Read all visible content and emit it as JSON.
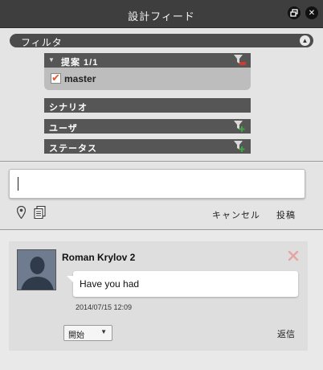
{
  "window": {
    "title": "設計フィード"
  },
  "filter": {
    "label": "フィルタ",
    "proposal": {
      "label": "提案 1/1",
      "item": {
        "label": "master",
        "checked": true
      }
    },
    "scenario": {
      "label": "シナリオ"
    },
    "user": {
      "label": "ユーザ"
    },
    "status": {
      "label": "ステータス"
    }
  },
  "composer": {
    "value": "",
    "cancel_label": "キャンセル",
    "post_label": "投稿"
  },
  "feed": {
    "posts": [
      {
        "author": "Roman Krylov 2",
        "message": "Have you had",
        "timestamp": "2014/07/15 12:09",
        "status": "開始",
        "reply_label": "返信"
      }
    ]
  },
  "colors": {
    "titlebar": "#3e3e3e",
    "panel_header": "#565656",
    "funnel_red": "#d33a2c",
    "funnel_green": "#3fa53f",
    "check_orange": "#e0582a",
    "delete_pink": "#e7a4a4"
  },
  "icons": {
    "restore": "restore-window-icon",
    "close": "close-icon",
    "collapse": "chevron-up-icon",
    "filter_remove": "filter-remove-icon",
    "filter_add": "filter-add-icon",
    "location": "map-pin-icon",
    "attach": "document-attach-icon",
    "delete": "delete-x-icon",
    "avatar": "user-silhouette-icon"
  }
}
